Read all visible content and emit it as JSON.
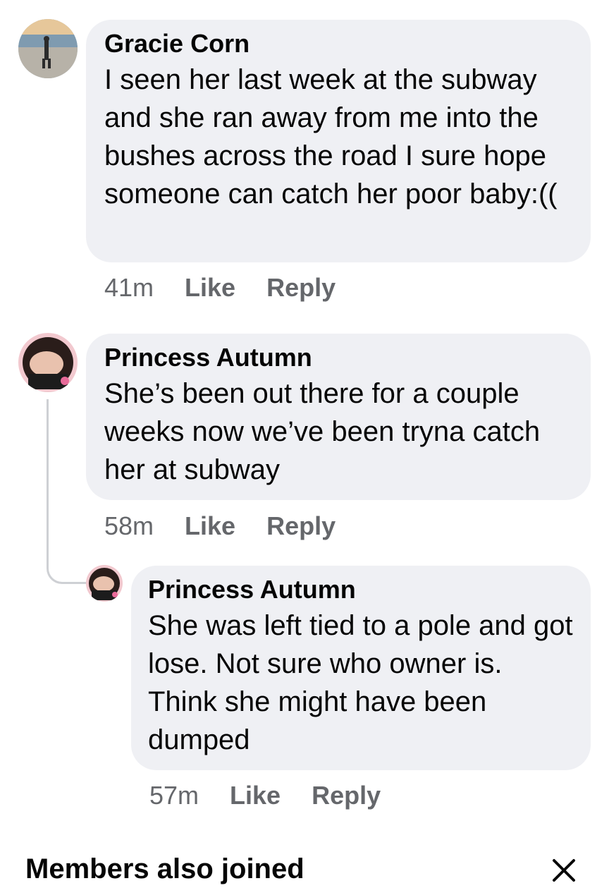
{
  "comments": [
    {
      "author": "Gracie Corn",
      "text": "I seen her last week at the subway and she ran away from me into the bushes across the road I sure hope someone can catch her poor baby:((",
      "time": "41m",
      "like_label": "Like",
      "reply_label": "Reply"
    },
    {
      "author": "Princess Autumn",
      "text": "She’s been out there for a couple weeks now we’ve been tryna catch her at subway",
      "time": "58m",
      "like_label": "Like",
      "reply_label": "Reply"
    },
    {
      "author": "Princess Autumn",
      "text": "She was left tied to a pole and got lose. Not sure who owner is. Think she might have been dumped",
      "time": "57m",
      "like_label": "Like",
      "reply_label": "Reply"
    }
  ],
  "members_section": {
    "title": "Members also joined"
  },
  "icons": {
    "close": "close-icon"
  },
  "colors": {
    "bubble": "#eff0f4",
    "meta_text": "#65676b",
    "thread_line": "#ced0d4"
  }
}
